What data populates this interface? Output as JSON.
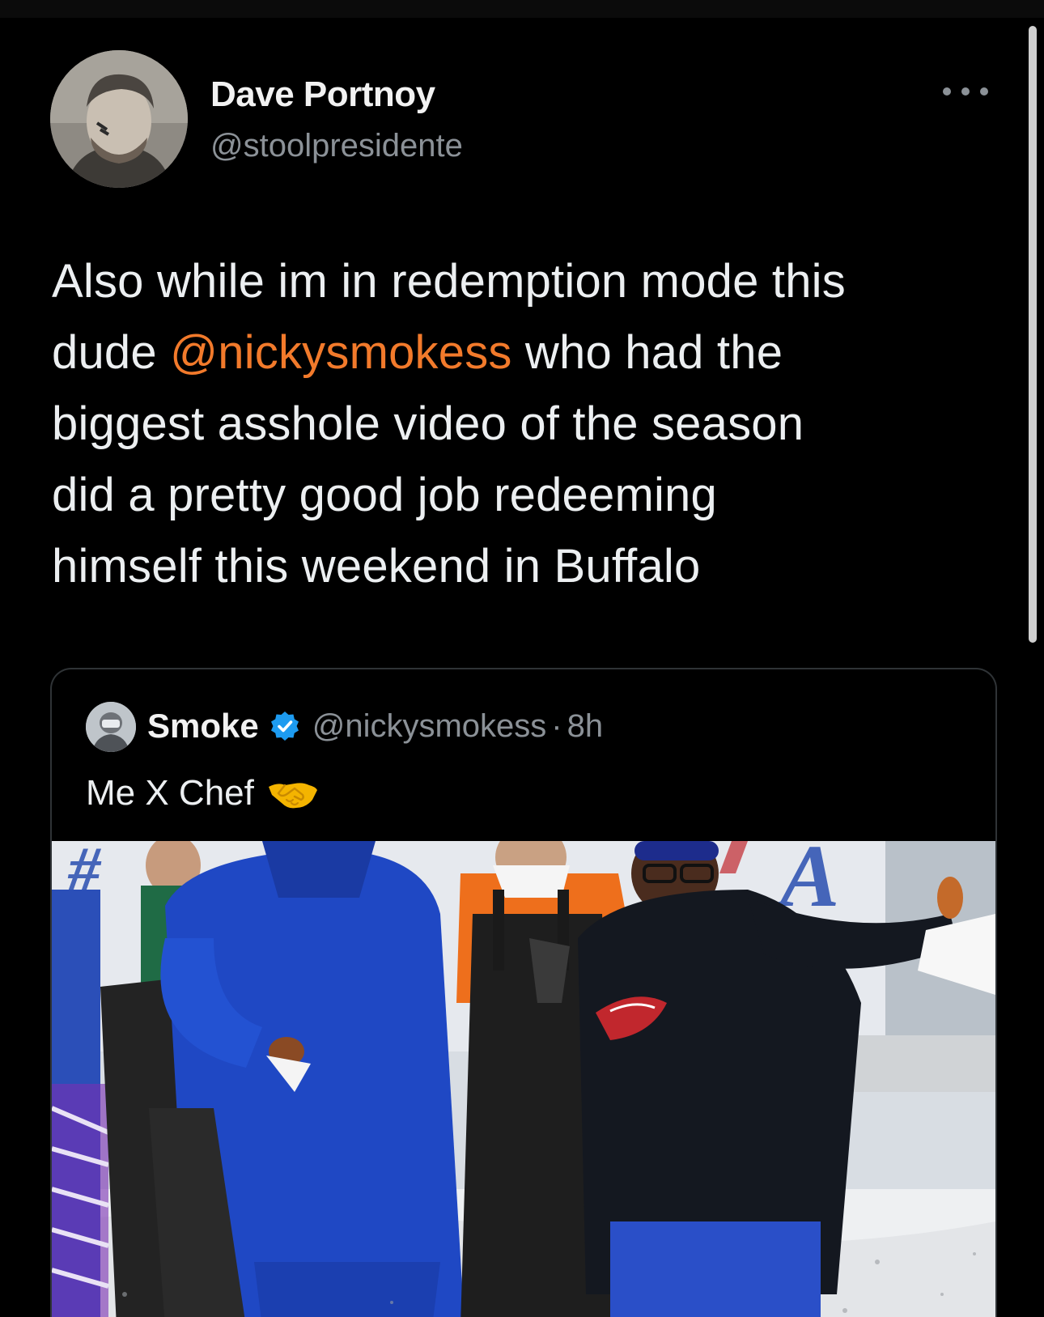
{
  "author": {
    "display_name": "Dave Portnoy",
    "handle": "@stoolpresidente",
    "avatar_icon": "profile-photo"
  },
  "menu": {
    "icon": "more-dots-icon"
  },
  "tweet": {
    "lines": [
      {
        "text": "Also while im in redemption mode this"
      },
      {
        "before": "dude ",
        "mention": "@nickysmokess",
        "after": " who had the"
      },
      {
        "text": "biggest asshole video of the season"
      },
      {
        "text": "did a pretty good job redeeming"
      },
      {
        "text": "himself this weekend in Buffalo"
      }
    ]
  },
  "quoted_tweet": {
    "display_name": "Smoke",
    "verified": true,
    "handle": "@nickysmokess",
    "separator": "·",
    "time": "8h",
    "text": "Me X Chef",
    "emoji": "handshake-icon",
    "media": "photo of four people at a snowy Buffalo Bills tailgate"
  },
  "colors": {
    "background": "#000000",
    "text": "#eceff1",
    "secondary_text": "#8b9197",
    "mention": "#f27a2b",
    "verified": "#1d9bf0",
    "card_border": "#2f3336"
  }
}
